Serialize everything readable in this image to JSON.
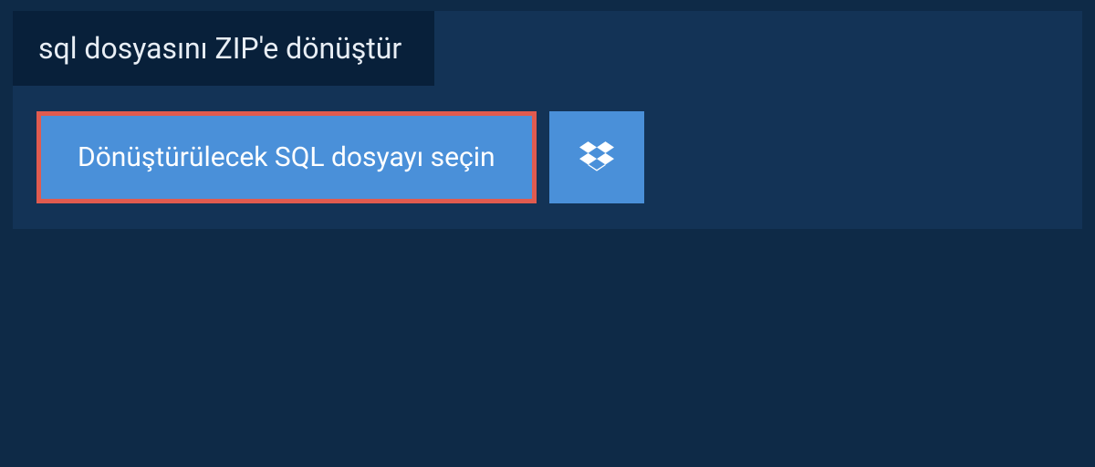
{
  "header": {
    "title": "sql dosyasını ZIP'e dönüştür"
  },
  "actions": {
    "select_file_label": "Dönüştürülecek SQL dosyayı seçin",
    "dropbox_icon": "dropbox-icon"
  },
  "colors": {
    "page_bg": "#0e2a47",
    "card_bg": "#133356",
    "tab_bg": "#08203a",
    "button_bg": "#4a90d9",
    "highlight_border": "#e05b4f",
    "text": "#ffffff"
  }
}
